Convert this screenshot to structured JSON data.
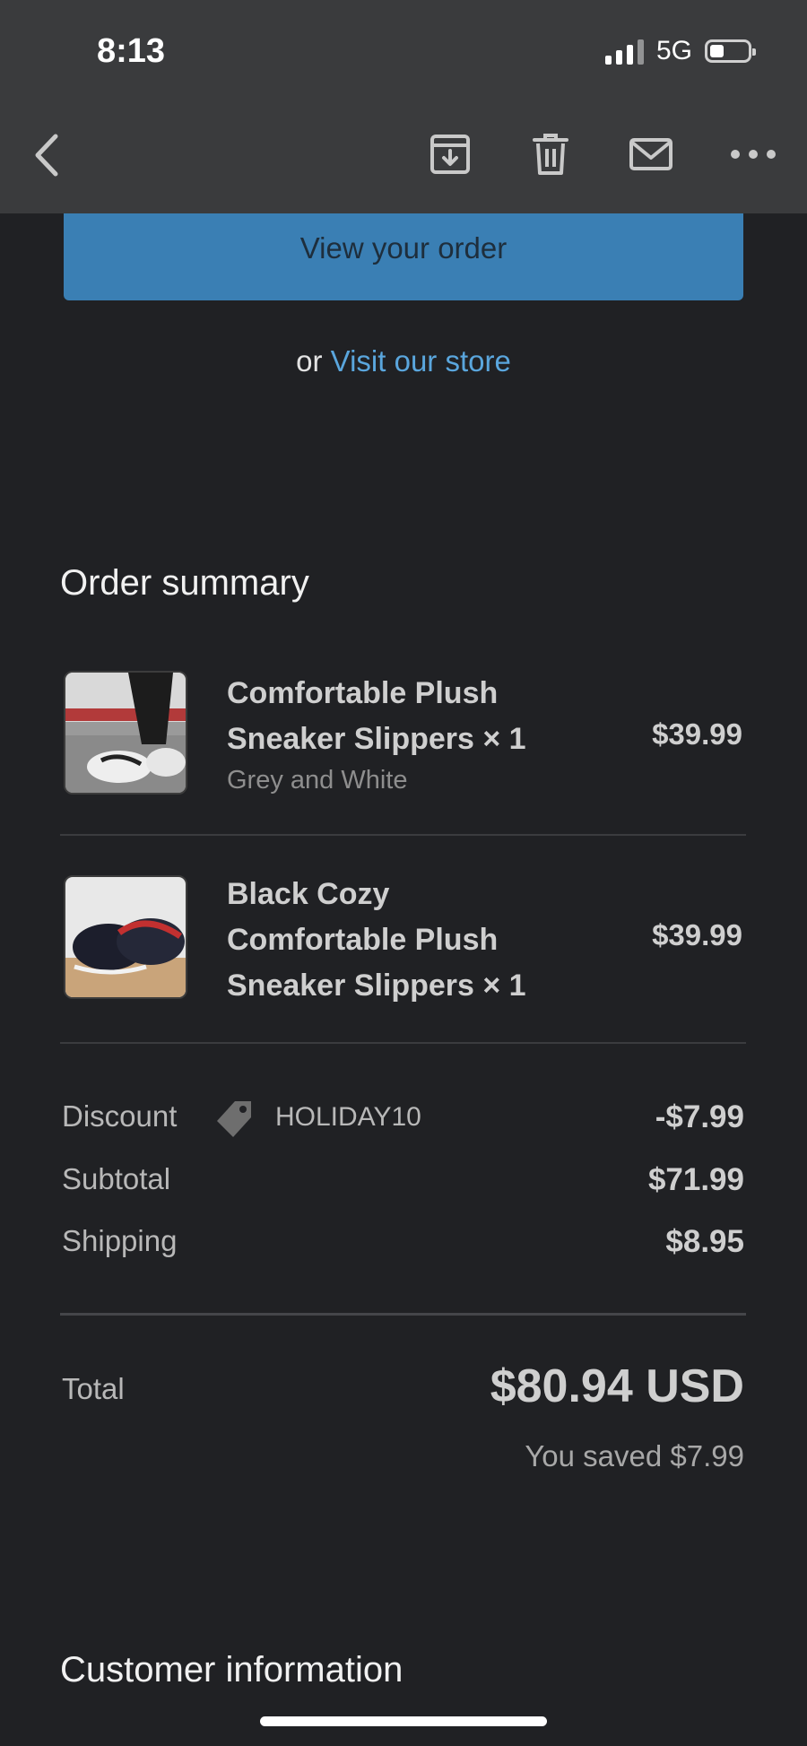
{
  "status_bar": {
    "time": "8:13",
    "network": "5G"
  },
  "toolbar": {
    "back": "back-icon",
    "archive": "archive-icon",
    "delete": "trash-icon",
    "mark_unread": "mail-icon",
    "more": "more-icon"
  },
  "order_button": {
    "label": "View your order"
  },
  "store_line": {
    "prefix": "or",
    "link": "Visit our store"
  },
  "summary": {
    "title": "Order summary",
    "items": [
      {
        "name": "Comfortable Plush Sneaker Slippers × 1",
        "variant": "Grey and White",
        "price": "$39.99"
      },
      {
        "name": "Black Cozy Comfortable Plush Sneaker Slippers × 1",
        "variant": "",
        "price": "$39.99"
      }
    ],
    "discount": {
      "label": "Discount",
      "code": "HOLIDAY10",
      "value": "-$7.99"
    },
    "subtotal": {
      "label": "Subtotal",
      "value": "$71.99"
    },
    "shipping": {
      "label": "Shipping",
      "value": "$8.95"
    },
    "total": {
      "label": "Total",
      "value": "$80.94 USD",
      "saved": "You saved $7.99"
    }
  },
  "customer": {
    "title": "Customer information"
  },
  "colors": {
    "accent": "#3a7fb4",
    "link": "#5aa6dd",
    "background": "#202124"
  }
}
